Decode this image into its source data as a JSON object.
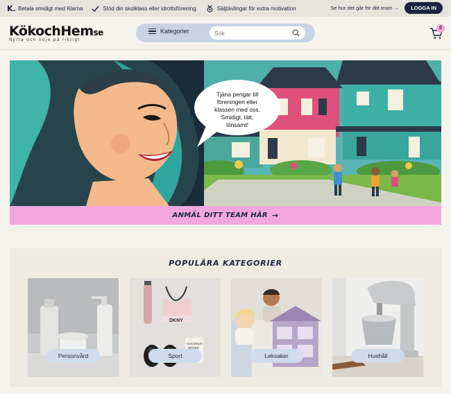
{
  "topbar": {
    "usps": [
      {
        "icon": "klarna-icon",
        "text": "Betala smidigt med Klarna"
      },
      {
        "icon": "checkmark-icon",
        "text": "Stöd din skolklass eller idrottsförening"
      },
      {
        "icon": "medal-icon",
        "text": "Säljtävlingar för extra motivation"
      }
    ],
    "team_link": "Se hur det går för ditt team",
    "team_arrow": "→",
    "login_label": "LOGGA IN"
  },
  "header": {
    "logo_main": "KökochHem",
    "logo_suffix": "se",
    "logo_tagline": "Nytta och nöje på riktigt",
    "categories_label": "Kategorier",
    "search_placeholder": "Sök",
    "cart_count": "0"
  },
  "hero": {
    "bubble_lines": [
      "Tjäna pengar till",
      "föreningen eller",
      "klassen med oss.",
      "Smidigt, lätt,",
      "lönsamt!"
    ],
    "cta_label": "ANMÄL DITT TEAM HÄR",
    "cta_arrow": "→"
  },
  "categories": {
    "title": "POPULÄRA KATEGORIER",
    "items": [
      {
        "label": "Personvård"
      },
      {
        "label": "Sport"
      },
      {
        "label": "Leksaker"
      },
      {
        "label": "Hushåll"
      }
    ]
  },
  "colors": {
    "navy": "#1c2440",
    "pink": "#f2a7df",
    "pill_blue": "#c8d3e6",
    "label_blue": "#d0dbed",
    "page_bg": "#f5f3ec"
  }
}
